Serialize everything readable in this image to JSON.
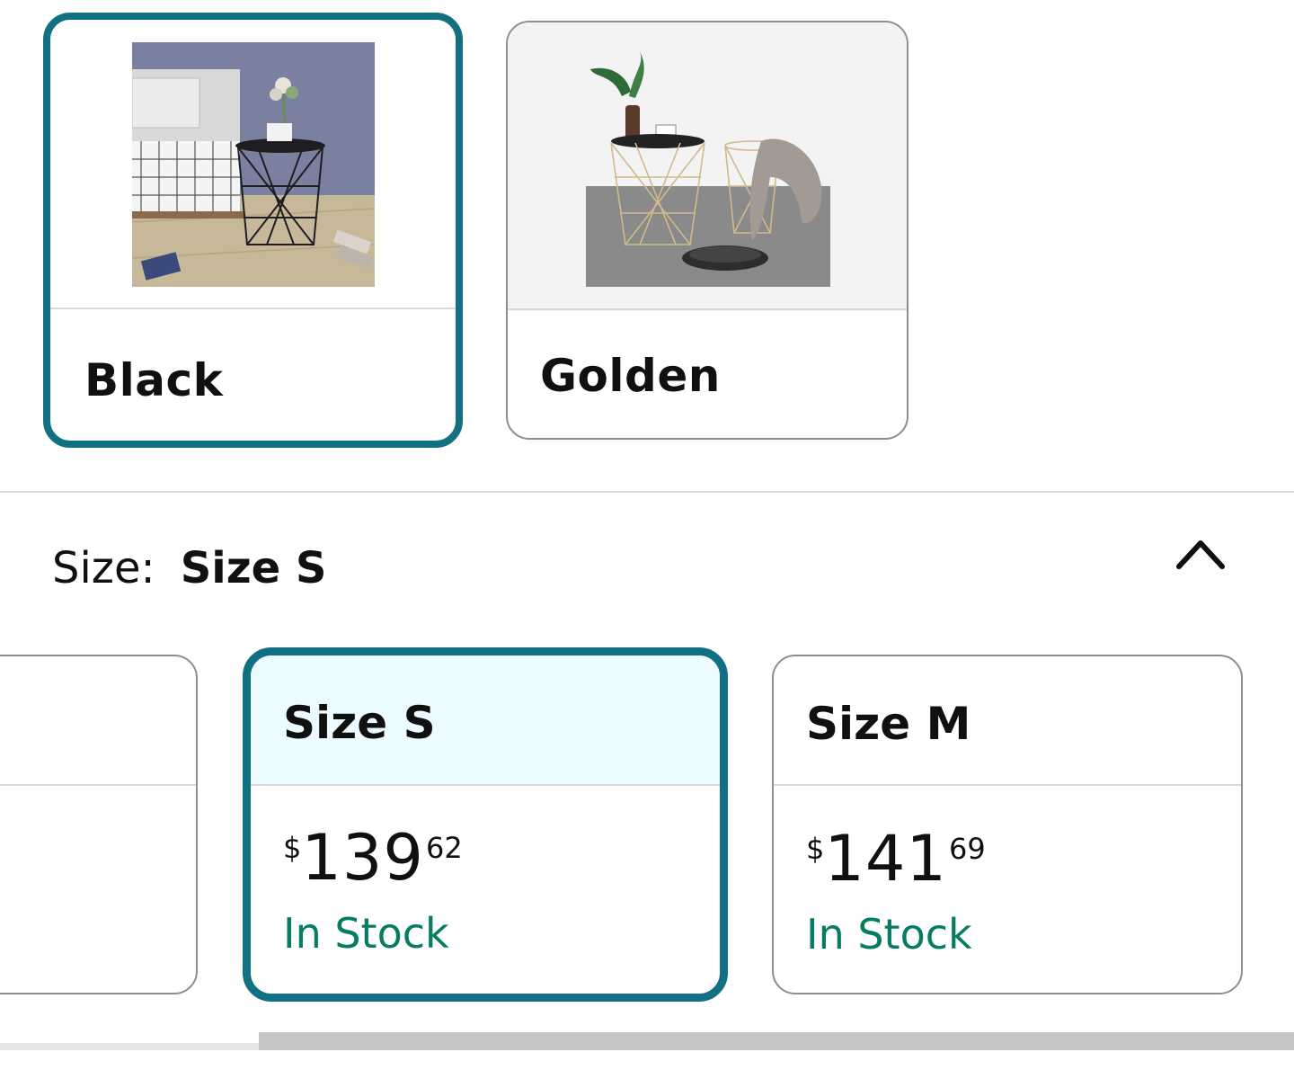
{
  "colors": {
    "accent": "#127083",
    "selected_background": "#ebfbff",
    "stock_green": "#067d62",
    "border_gray": "#8a8f94"
  },
  "color_options": [
    {
      "label": "Black",
      "selected": true,
      "image": "black wire basket side table by bed"
    },
    {
      "label": "Golden",
      "selected": false,
      "image": "golden wire basket side tables with tray"
    }
  ],
  "size_header": {
    "label": "Size:",
    "value": "Size S",
    "toggle_icon": "chevron-up-icon"
  },
  "size_options": [
    {
      "label": "",
      "price_symbol": "",
      "price_whole": "",
      "price_fraction": "",
      "stock": "",
      "selected": false
    },
    {
      "label": "Size S",
      "price_symbol": "$",
      "price_whole": "139",
      "price_fraction": "62",
      "stock": "In Stock",
      "selected": true
    },
    {
      "label": "Size M",
      "price_symbol": "$",
      "price_whole": "141",
      "price_fraction": "69",
      "stock": "In Stock",
      "selected": false
    }
  ],
  "scrollbar": {
    "position_fraction": 0.2
  }
}
